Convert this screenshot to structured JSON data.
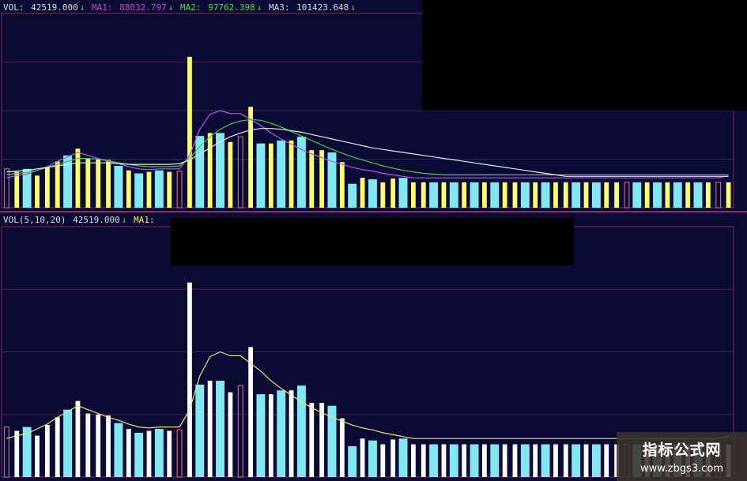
{
  "panel1": {
    "label": "VOL:",
    "vol": "42519.000",
    "ma1_label": "MA1:",
    "ma1": "88032.797",
    "ma2_label": "MA2:",
    "ma2": "97762.398",
    "ma3_label": "MA3:",
    "ma3": "101423.648",
    "arrow": "↓"
  },
  "panel2": {
    "label": "VOL(5,10,20)",
    "vol": "42519.000",
    "ma1_label": "MA1:",
    "arrow": "↓"
  },
  "watermark": {
    "title": "指标公式网",
    "url": "www.zbgs3.com"
  },
  "colors": {
    "background": "#0a0a35",
    "up_outline": "#c8646e",
    "down_fill_cyan": "#7fe8f0",
    "yellow": "#ffff66",
    "white": "#ffffff",
    "ma_white": "#e6e6e6",
    "ma_yellow": "#f0e070",
    "ma_purple": "#c050ff",
    "ma_green": "#40d040",
    "label_white": "#dddddd",
    "label_yellow": "#f0f060",
    "label_purple": "#d040d0",
    "label_green": "#40e040",
    "label_cyan": "#60c0ff"
  },
  "chart_data": [
    {
      "type": "bar",
      "ylim": [
        0,
        260000
      ],
      "values": [
        52000,
        48000,
        52000,
        43000,
        54000,
        62000,
        70000,
        79000,
        66000,
        65000,
        64000,
        56000,
        50000,
        46000,
        48000,
        50000,
        48000,
        49000,
        202000,
        96000,
        100000,
        100000,
        88000,
        95000,
        135000,
        86000,
        86000,
        90000,
        90000,
        95000,
        77000,
        77000,
        74000,
        61000,
        32000,
        40000,
        38000,
        34000,
        39000,
        40000,
        34000,
        34000,
        34000,
        34000,
        34000,
        34000,
        34000,
        34000,
        34000,
        34000,
        34000,
        34000,
        34000,
        34000,
        34000,
        34000,
        34000,
        34000,
        34000,
        34000,
        34000,
        34000,
        34000,
        34000,
        34000,
        34000,
        34000,
        34000,
        34000,
        34000,
        34000,
        34000
      ],
      "series": [
        {
          "name": "MA1",
          "values": [
            40000,
            43000,
            45000,
            50000,
            55000,
            62000,
            68000,
            74000,
            70000,
            66000,
            62000,
            59000,
            55000,
            52000,
            51000,
            52000,
            52000,
            52000,
            70000,
            105000,
            125000,
            130000,
            126000,
            126000,
            118000,
            110000,
            100000,
            92000,
            85000,
            78000,
            72000,
            67000,
            62000,
            58000,
            54000,
            51000,
            49000,
            46000,
            44000,
            42000,
            40000,
            40000,
            40000,
            40000,
            40000,
            40000,
            40000,
            40000,
            40000,
            40000,
            40000,
            40000,
            40000,
            40000,
            40000,
            40000,
            40000,
            40000,
            40000,
            40000,
            40000,
            40000,
            40000,
            40000,
            40000,
            40000,
            40000,
            40000,
            40000,
            40000,
            40000,
            42519
          ]
        },
        {
          "name": "MA2",
          "values": [
            44000,
            46000,
            47000,
            50000,
            54000,
            58000,
            62000,
            66000,
            66000,
            65000,
            63000,
            60000,
            58000,
            56000,
            55000,
            55000,
            55000,
            56000,
            66000,
            82000,
            95000,
            105000,
            112000,
            116000,
            118000,
            117000,
            113000,
            108000,
            102000,
            96000,
            90000,
            84000,
            78000,
            73000,
            68000,
            64000,
            60000,
            56000,
            53000,
            50000,
            48000,
            46000,
            45000,
            44000,
            44000,
            44000,
            44000,
            44000,
            44000,
            44000,
            44000,
            44000,
            44000,
            44000,
            44000,
            44000,
            44000,
            44000,
            44000,
            44000,
            44000,
            44000,
            44000,
            44000,
            44000,
            44000,
            44000,
            44000,
            44000,
            44000,
            44000,
            44000
          ]
        },
        {
          "name": "MA3",
          "values": [
            48000,
            49000,
            50000,
            52000,
            54000,
            56000,
            58000,
            60000,
            60000,
            60000,
            60000,
            59000,
            58000,
            58000,
            58000,
            58000,
            58000,
            59000,
            64000,
            72000,
            80000,
            88000,
            95000,
            100000,
            104000,
            106000,
            106000,
            105000,
            103000,
            101000,
            98000,
            95000,
            92000,
            89000,
            86000,
            83000,
            80000,
            78000,
            76000,
            74000,
            72000,
            70000,
            68000,
            66000,
            64000,
            62000,
            60000,
            58000,
            56000,
            54000,
            52000,
            50000,
            48000,
            46000,
            44000,
            42000,
            42000,
            42000,
            42000,
            42000,
            42000,
            42000,
            42000,
            42000,
            42000,
            42000,
            42000,
            42000,
            42000,
            42000,
            42000,
            42000
          ]
        }
      ]
    },
    {
      "type": "bar",
      "ylim": [
        0,
        260000
      ],
      "values": [
        52000,
        48000,
        52000,
        43000,
        54000,
        62000,
        70000,
        79000,
        66000,
        65000,
        64000,
        56000,
        50000,
        46000,
        48000,
        50000,
        48000,
        49000,
        202000,
        96000,
        100000,
        100000,
        88000,
        95000,
        135000,
        86000,
        86000,
        90000,
        90000,
        95000,
        77000,
        77000,
        74000,
        61000,
        32000,
        40000,
        38000,
        34000,
        39000,
        40000,
        34000,
        34000,
        34000,
        34000,
        34000,
        34000,
        34000,
        34000,
        34000,
        34000,
        34000,
        34000,
        34000,
        34000,
        34000,
        34000,
        34000,
        34000,
        34000,
        34000,
        34000,
        34000,
        34000,
        34000,
        34000,
        34000,
        34000,
        34000,
        34000,
        34000,
        34000,
        34000
      ],
      "series": [
        {
          "name": "MA1",
          "values": [
            40000,
            43000,
            45000,
            50000,
            55000,
            62000,
            68000,
            74000,
            70000,
            66000,
            62000,
            59000,
            55000,
            52000,
            51000,
            52000,
            52000,
            52000,
            70000,
            105000,
            125000,
            130000,
            126000,
            126000,
            118000,
            110000,
            100000,
            92000,
            85000,
            78000,
            72000,
            67000,
            62000,
            58000,
            54000,
            51000,
            49000,
            46000,
            44000,
            42000,
            40000,
            40000,
            40000,
            40000,
            40000,
            40000,
            40000,
            40000,
            40000,
            40000,
            40000,
            40000,
            40000,
            40000,
            40000,
            40000,
            40000,
            40000,
            40000,
            40000,
            40000,
            40000,
            40000,
            40000,
            40000,
            40000,
            40000,
            40000,
            40000,
            40000,
            40000,
            42519
          ]
        }
      ]
    }
  ]
}
